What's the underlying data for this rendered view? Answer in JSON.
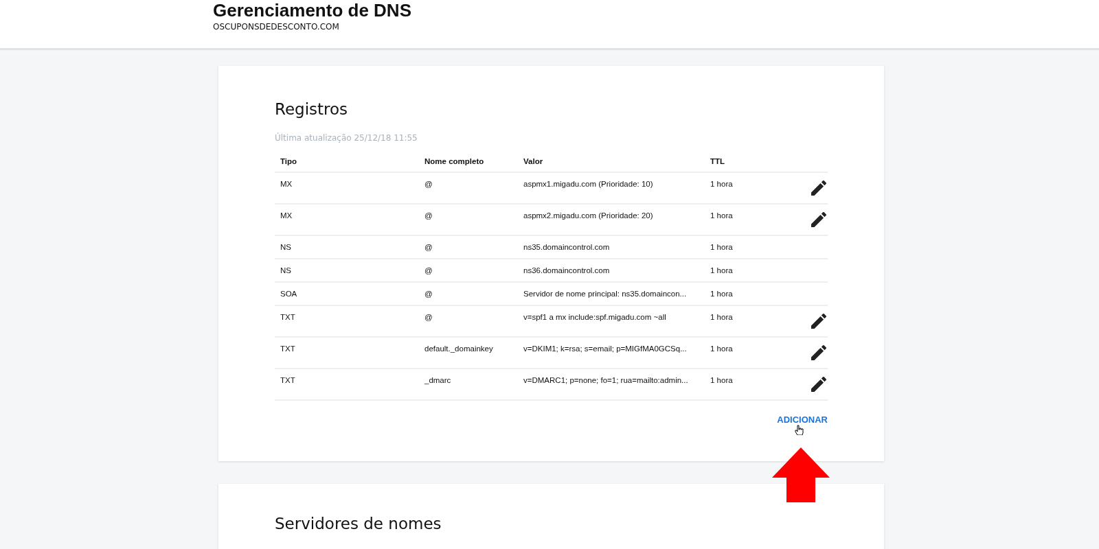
{
  "header": {
    "title": "Gerenciamento de DNS",
    "domain": "OSCUPONSDEDESCONTO.COM"
  },
  "records": {
    "title": "Registros",
    "updated": "Última atualização 25/12/18 11:55",
    "columns": [
      "Tipo",
      "Nome completo",
      "Valor",
      "TTL"
    ],
    "rows": [
      {
        "type": "MX",
        "name": "@",
        "value": "aspmx1.migadu.com (Prioridade: 10)",
        "ttl": "1 hora",
        "editable": true
      },
      {
        "type": "MX",
        "name": "@",
        "value": "aspmx2.migadu.com (Prioridade: 20)",
        "ttl": "1 hora",
        "editable": true
      },
      {
        "type": "NS",
        "name": "@",
        "value": "ns35.domaincontrol.com",
        "ttl": "1 hora",
        "editable": false
      },
      {
        "type": "NS",
        "name": "@",
        "value": "ns36.domaincontrol.com",
        "ttl": "1 hora",
        "editable": false
      },
      {
        "type": "SOA",
        "name": "@",
        "value": "Servidor de nome principal: ns35.domaincon...",
        "ttl": "1 hora",
        "editable": false
      },
      {
        "type": "TXT",
        "name": "@",
        "value": "v=spf1 a mx include:spf.migadu.com ~all",
        "ttl": "1 hora",
        "editable": true
      },
      {
        "type": "TXT",
        "name": "default._domainkey",
        "value": "v=DKIM1; k=rsa; s=email; p=MIGfMA0GCSq...",
        "ttl": "1 hora",
        "editable": true
      },
      {
        "type": "TXT",
        "name": "_dmarc",
        "value": "v=DMARC1; p=none; fo=1; rua=mailto:admin...",
        "ttl": "1 hora",
        "editable": true
      }
    ],
    "add_button": "ADICIONAR"
  },
  "nameservers": {
    "title": "Servidores de nomes"
  }
}
